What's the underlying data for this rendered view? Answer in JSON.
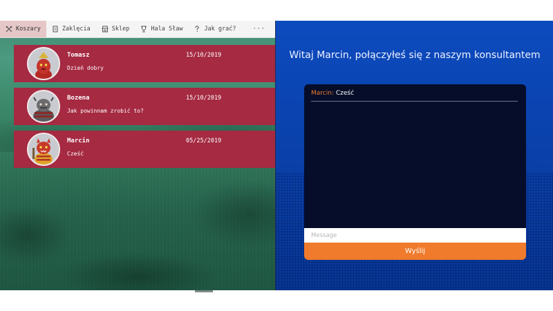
{
  "nav": {
    "items": [
      {
        "label": "Koszary",
        "icon": "swords-icon",
        "active": true
      },
      {
        "label": "Zaklęcia",
        "icon": "scroll-icon",
        "active": false
      },
      {
        "label": "Sklep",
        "icon": "shop-icon",
        "active": false
      },
      {
        "label": "Hala Sław",
        "icon": "trophy-icon",
        "active": false
      },
      {
        "label": "Jak grać?",
        "icon": "question-icon",
        "active": false
      }
    ],
    "more_label": "···"
  },
  "chats": [
    {
      "name": "Tomasz",
      "date": "15/10/2019",
      "message": "Dzień dobry",
      "avatar": "red-goblin-avatar"
    },
    {
      "name": "Bozena",
      "date": "15/10/2019",
      "message": "Jak powinnam zrobić to?",
      "avatar": "grey-ogre-avatar"
    },
    {
      "name": "Marcin",
      "date": "05/25/2019",
      "message": "Cześć",
      "avatar": "red-beast-avatar"
    }
  ],
  "chat_panel": {
    "welcome": "Witaj Marcin, połączyłeś się z naszym konsultantem",
    "messages": [
      {
        "author": "Marcin:",
        "text": "Cześć"
      }
    ],
    "input_placeholder": "Message",
    "input_value": "",
    "send_label": "Wyślij"
  },
  "colors": {
    "card_bg": "#a52a42",
    "accent_orange": "#f07b2c",
    "right_bg": "#0a3fa7",
    "chatbox_bg": "#050d2a",
    "nav_active_bg": "#e6c7c7"
  }
}
